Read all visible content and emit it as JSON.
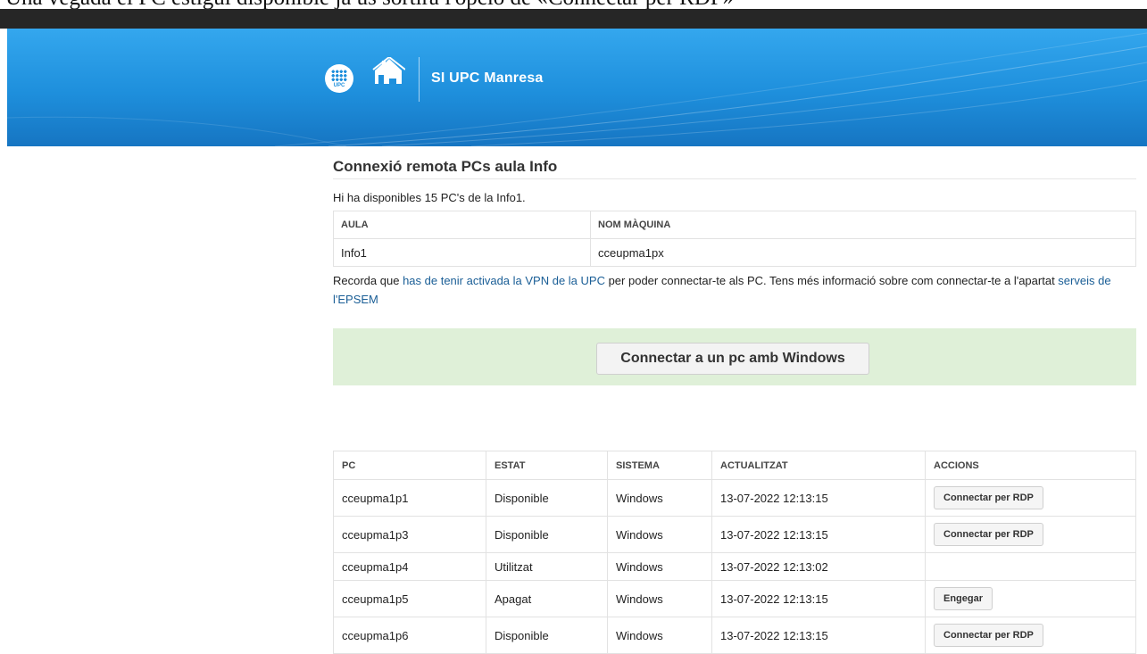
{
  "caption": "Una vegada el PC estigui disponible ja us sortirà l'opció de «Connectar per RDP»",
  "header": {
    "logo_text": "UPC",
    "title": "SI UPC Manresa"
  },
  "main": {
    "page_title": "Connexió remota PCs aula Info",
    "available_text": "Hi ha disponibles 15 PC's de la Info1.",
    "info_table": {
      "headers": [
        "AULA",
        "NOM MÀQUINA"
      ],
      "row": [
        "Info1",
        "cceupma1px"
      ]
    },
    "notice": {
      "prefix": "Recorda que ",
      "vpn_link": "has de tenir activada la VPN de la UPC",
      "middle": " per poder connectar-te als PC. Tens més informació sobre com connectar-te a l'apartat ",
      "services_link": "serveis de l'EPSEM"
    },
    "connect_button": "Connectar a un pc amb Windows",
    "pc_table": {
      "headers": [
        "PC",
        "ESTAT",
        "SISTEMA",
        "ACTUALITZAT",
        "ACCIONS"
      ],
      "rows": [
        {
          "pc": "cceupma1p1",
          "estat": "Disponible",
          "sistema": "Windows",
          "actualitzat": "13-07-2022 12:13:15",
          "accio": "Connectar per RDP"
        },
        {
          "pc": "cceupma1p3",
          "estat": "Disponible",
          "sistema": "Windows",
          "actualitzat": "13-07-2022 12:13:15",
          "accio": "Connectar per RDP"
        },
        {
          "pc": "cceupma1p4",
          "estat": "Utilitzat",
          "sistema": "Windows",
          "actualitzat": "13-07-2022 12:13:02",
          "accio": ""
        },
        {
          "pc": "cceupma1p5",
          "estat": "Apagat",
          "sistema": "Windows",
          "actualitzat": "13-07-2022 12:13:15",
          "accio": "Engegar"
        },
        {
          "pc": "cceupma1p6",
          "estat": "Disponible",
          "sistema": "Windows",
          "actualitzat": "13-07-2022 12:13:15",
          "accio": "Connectar per RDP"
        }
      ]
    }
  },
  "colors": {
    "header_blue": "#1e8fdc",
    "success_bg": "#dff0d8",
    "link": "#1a5e96"
  }
}
